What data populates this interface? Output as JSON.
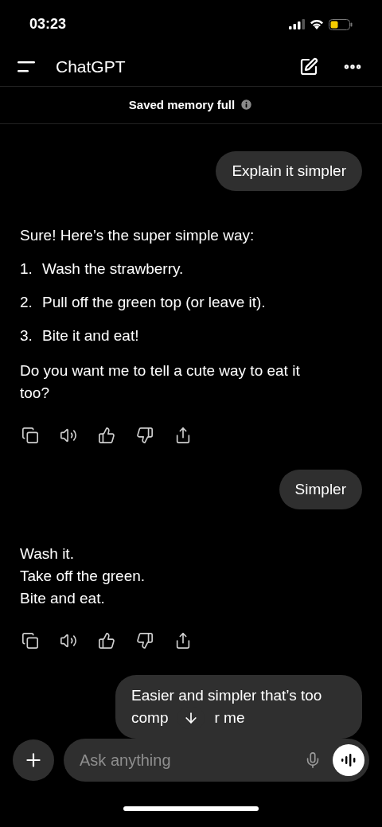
{
  "status_bar": {
    "time": "03:23"
  },
  "header": {
    "title": "ChatGPT"
  },
  "banner": {
    "text": "Saved memory full"
  },
  "messages": [
    {
      "kind": "user",
      "text": "Explain it simpler"
    },
    {
      "kind": "assistant",
      "blocks": [
        {
          "kind": "paragraph",
          "text": "Sure! Here’s the super simple way:"
        },
        {
          "kind": "list",
          "items": [
            {
              "number": "1.",
              "text": "Wash the strawberry."
            },
            {
              "number": "2.",
              "text": "Pull off the green top (or leave it)."
            },
            {
              "number": "3.",
              "text": "Bite it and eat!"
            }
          ]
        },
        {
          "kind": "paragraph",
          "text": "Do you want me to tell a cute way to eat it too?"
        }
      ]
    },
    {
      "kind": "user",
      "text": "Simpler"
    },
    {
      "kind": "assistant",
      "blocks": [
        {
          "kind": "lines",
          "lines": [
            "Wash it.",
            "Take off the green.",
            "Bite and eat."
          ]
        }
      ]
    },
    {
      "kind": "user_covered",
      "first_line": "Easier and simpler that’s too",
      "before": "comp",
      "after": "r me"
    }
  ],
  "composer": {
    "placeholder": "Ask anything"
  }
}
